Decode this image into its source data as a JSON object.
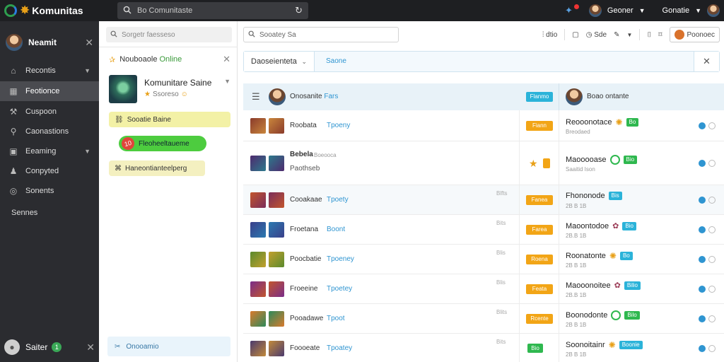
{
  "topbar": {
    "brand": "Komunitas",
    "search_placeholder": "Bo Comunitaste",
    "account_name": "Geoner",
    "user_name": "Gonatie"
  },
  "sidebar": {
    "user_name": "Neamit",
    "items": [
      {
        "label": "Recontis",
        "icon": "home-icon",
        "chevron": true
      },
      {
        "label": "Feotionce",
        "icon": "grid-icon",
        "active": true
      },
      {
        "label": "Cuspoon",
        "icon": "wrench-icon"
      },
      {
        "label": "Caonastions",
        "icon": "search-icon"
      },
      {
        "label": "Eeaming",
        "icon": "briefcase-icon",
        "chevron": true
      },
      {
        "label": "Conpyted",
        "icon": "person-icon"
      },
      {
        "label": "Sonents",
        "icon": "globe-icon"
      }
    ],
    "settings_label": "Sennes",
    "bottom_user": "Saiter",
    "bottom_badge": "1"
  },
  "middle": {
    "search_placeholder": "Sorgetr faesseso",
    "header_prefix": "Nouboaole",
    "header_status": "Online",
    "community_title": "Komunitare Saine",
    "community_sub": "Ssoreso",
    "pill1": "Sooatie Baine",
    "pill2_badge": "10",
    "pill2": "Fleoheeltaueme",
    "pill3": "Haneontianteelperg",
    "bottom_label": "Onooamio"
  },
  "main": {
    "search_placeholder": "Sooatey Sa",
    "tool1": "dtio",
    "tool2": "Sde",
    "tool3": "Poonoec",
    "filter_dropdown": "Daoseienteta",
    "filter_link": "Saone",
    "header_title": "Onosanite",
    "header_highlight": "Fars",
    "header_tag": "Flanmo",
    "header_right": "Boao ontante",
    "rows": [
      {
        "label": "Roobata",
        "link": "Tpoeny",
        "num": "",
        "tag": "Fiann",
        "name": "Reooonotace",
        "sub": "Breodaed",
        "marker": "sun",
        "chip": "Bo",
        "chipColor": "green"
      },
      {
        "label": "Bebela",
        "label2": "Paothseb",
        "link": "Boeooca",
        "num": "",
        "tag": "",
        "name": "Maooooase",
        "sub": "Saaitid Ison",
        "marker": "ring",
        "chip": "Bio",
        "chipColor": "green"
      },
      {
        "label": "Cooakaae",
        "link": "Tpoety",
        "num": "Blfts",
        "tag": "Fanea",
        "name": "Fhononode",
        "sub": "2B B 1B",
        "marker": "",
        "chip": "Bis",
        "chipColor": "teal"
      },
      {
        "label": "Froetana",
        "link": "Boont",
        "num": "Bits",
        "tag": "Farea",
        "name": "Maoontodoe",
        "sub": "2B.B 1B",
        "marker": "pin",
        "chip": "Bio",
        "chipColor": "teal"
      },
      {
        "label": "Poocbatie",
        "link": "Tpoeney",
        "num": "Blis",
        "tag": "Roena",
        "name": "Roonatonte",
        "sub": "2B B 1B",
        "marker": "sun",
        "chip": "Bo",
        "chipColor": "teal"
      },
      {
        "label": "Froeeine",
        "link": "Tpoetey",
        "num": "Blis",
        "tag": "Feata",
        "name": "Maooonoitee",
        "sub": "2B.B 1B",
        "marker": "pin",
        "chip": "Bilio",
        "chipColor": "teal"
      },
      {
        "label": "Pooadawe",
        "link": "Tpoot",
        "num": "Blits",
        "tag": "Rcente",
        "name": "Boonodonte",
        "sub": "2B B 1B",
        "marker": "ring",
        "chip": "Bilo",
        "chipColor": "green"
      },
      {
        "label": "Foooeate",
        "link": "Tpoatey",
        "num": "Bits",
        "tag": "Bio",
        "name": "Soonoitainr",
        "sub": "2B B 1B",
        "marker": "sun",
        "chip": "Boonie",
        "chipColor": "teal"
      }
    ]
  }
}
